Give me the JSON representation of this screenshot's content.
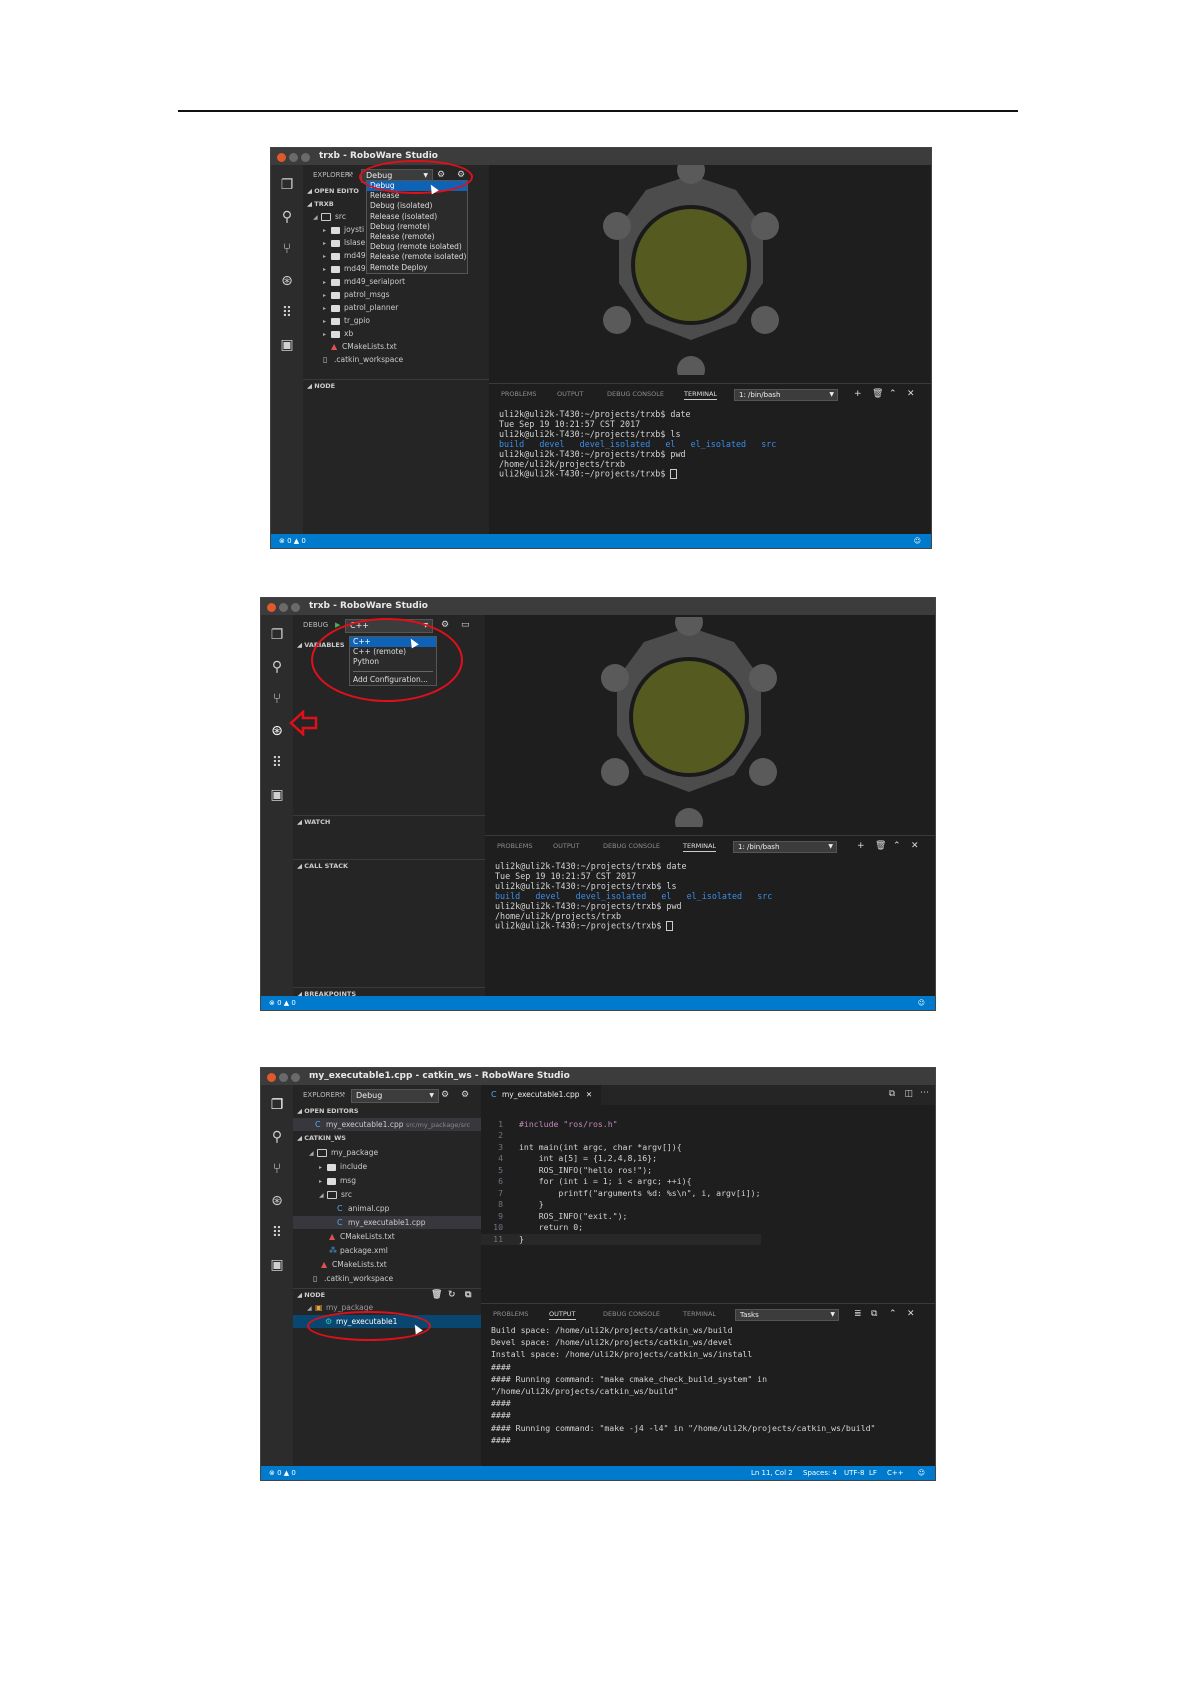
{
  "shot1": {
    "title": "trxb - RoboWare Studio",
    "explorer_label": "EXPLORER",
    "build_dropdown": "Debug",
    "build_menu": [
      "Debug",
      "Release",
      "Debug (isolated)",
      "Release (isolated)",
      "Debug (remote)",
      "Release (remote)",
      "Debug (remote isolated)",
      "Release (remote isolated)",
      "Remote Deploy"
    ],
    "open_editors": "OPEN EDITO",
    "project": "TRXB",
    "src": "src",
    "tree": [
      "joysti",
      "lslase",
      "md49",
      "md49",
      "md49_serialport",
      "patrol_msgs",
      "patrol_planner",
      "tr_gpio",
      "xb"
    ],
    "cmake": "CMakeLists.txt",
    "catkin": ".catkin_workspace",
    "node": "NODE",
    "status": "⊗ 0 ▲ 0"
  },
  "shot2": {
    "title": "trxb - RoboWare Studio",
    "debug_label": "DEBUG",
    "config_dropdown": "C++",
    "config_menu": [
      "C++",
      "C++ (remote)",
      "Python"
    ],
    "add_config": "Add Configuration...",
    "variables": "VARIABLES",
    "watch": "WATCH",
    "call_stack": "CALL STACK",
    "breakpoints": "BREAKPOINTS",
    "status": "⊗ 0 ▲ 0"
  },
  "terminal": {
    "tabs": [
      "PROBLEMS",
      "OUTPUT",
      "DEBUG CONSOLE",
      "TERMINAL"
    ],
    "shell": "1: /bin/bash",
    "lines": [
      "uli2k@uli2k-T430:~/projects/trxb$ date",
      "Tue Sep 19 10:21:57 CST 2017",
      "uli2k@uli2k-T430:~/projects/trxb$ ls"
    ],
    "ls_output": "build   devel   devel_isolated   el   el_isolated   src",
    "lines2": [
      "uli2k@uli2k-T430:~/projects/trxb$ pwd",
      "/home/uli2k/projects/trxb",
      "uli2k@uli2k-T430:~/projects/trxb$ "
    ]
  },
  "shot3": {
    "title": "my_executable1.cpp - catkin_ws - RoboWare Studio",
    "explorer_label": "EXPLORER",
    "build_dropdown": "Debug",
    "open_editors": "OPEN EDITORS",
    "open_file": "my_executable1.cpp",
    "open_file_path": "src/my_package/src",
    "workspace": "CATKIN_WS",
    "tree": {
      "pkg": "my_package",
      "include": "include",
      "msg": "msg",
      "src": "src",
      "animal": "animal.cpp",
      "exe": "my_executable1.cpp",
      "cmake_pkg": "CMakeLists.txt",
      "pkgxml": "package.xml",
      "cmake_ws": "CMakeLists.txt",
      "catkin": ".catkin_workspace"
    },
    "node": "NODE",
    "node_pkg": "my_package",
    "node_exe": "my_executable1",
    "tab": "my_executable1.cpp",
    "code": [
      "#include \"ros/ros.h\"",
      "",
      "int main(int argc, char *argv[]){",
      "    int a[5] = {1,2,4,8,16};",
      "    ROS_INFO(\"hello ros!\");",
      "    for (int i = 1; i < argc; ++i){",
      "        printf(\"arguments %d: %s\\n\", i, argv[i]);",
      "    }",
      "    ROS_INFO(\"exit.\");",
      "    return 0;",
      "}"
    ],
    "line_numbers": [
      "1",
      "2",
      "3",
      "4",
      "5",
      "6",
      "7",
      "8",
      "9",
      "10",
      "11"
    ],
    "panel_tabs": [
      "PROBLEMS",
      "OUTPUT",
      "DEBUG CONSOLE",
      "TERMINAL"
    ],
    "panel_dropdown": "Tasks",
    "output": [
      "Build space: /home/uli2k/projects/catkin_ws/build",
      "Devel space: /home/uli2k/projects/catkin_ws/devel",
      "Install space: /home/uli2k/projects/catkin_ws/install",
      "####",
      "#### Running command: \"make cmake_check_build_system\" in",
      "\"/home/uli2k/projects/catkin_ws/build\"",
      "####",
      "####",
      "#### Running command: \"make -j4 -l4\" in \"/home/uli2k/projects/catkin_ws/build\"",
      "####"
    ],
    "status_left": "⊗ 0 ▲ 0",
    "status_items": [
      "Ln 11, Col 2",
      "Spaces: 4",
      "UTF-8",
      "LF",
      "C++"
    ]
  }
}
